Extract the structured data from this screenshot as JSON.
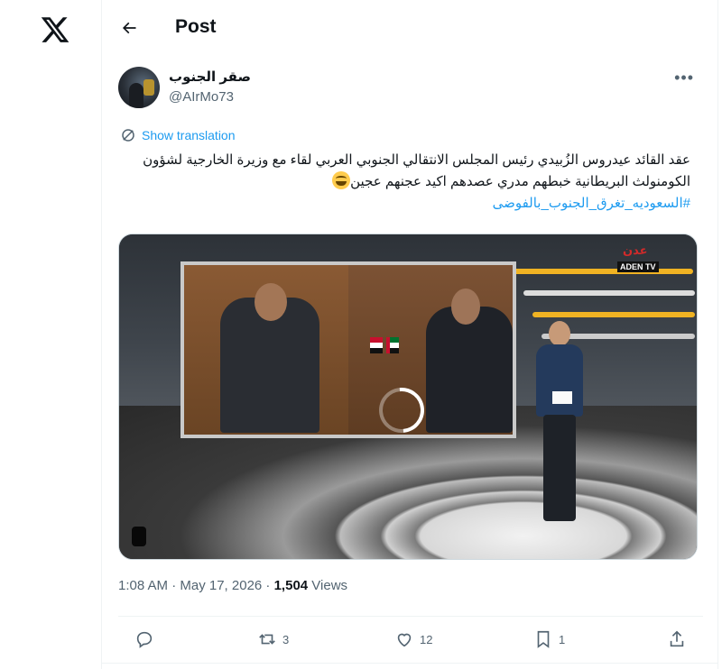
{
  "header": {
    "title": "Post"
  },
  "post": {
    "author": {
      "display_name": "صقر الجنوب",
      "handle": "@AIrMo73"
    },
    "show_translation": "Show translation",
    "text_lines": [
      "عقد القائد عيدروس الزُبيدي رئيس المجلس الانتقالي الجنوبي العربي  لقاء مع وزيرة الخارجية لشؤون",
      "الكومنولث البريطانية خبطهم مدري عصدهم اكيد عجنهم عجين"
    ],
    "hashtag": "#السعوديه_تغرق_الجنوب_بالفوضى",
    "media": {
      "channel_logo": "ADEN TV"
    },
    "timestamp": "1:08 AM · May 17, 2026 · ",
    "views_count": "1,504",
    "views_label": " Views"
  },
  "actions": {
    "reply": {
      "icon": "reply-icon",
      "count": ""
    },
    "repost": {
      "icon": "repost-icon",
      "count": "3"
    },
    "like": {
      "icon": "heart-icon",
      "count": "12"
    },
    "bookmark": {
      "icon": "bookmark-icon",
      "count": "1"
    },
    "share": {
      "icon": "share-icon",
      "count": ""
    }
  }
}
